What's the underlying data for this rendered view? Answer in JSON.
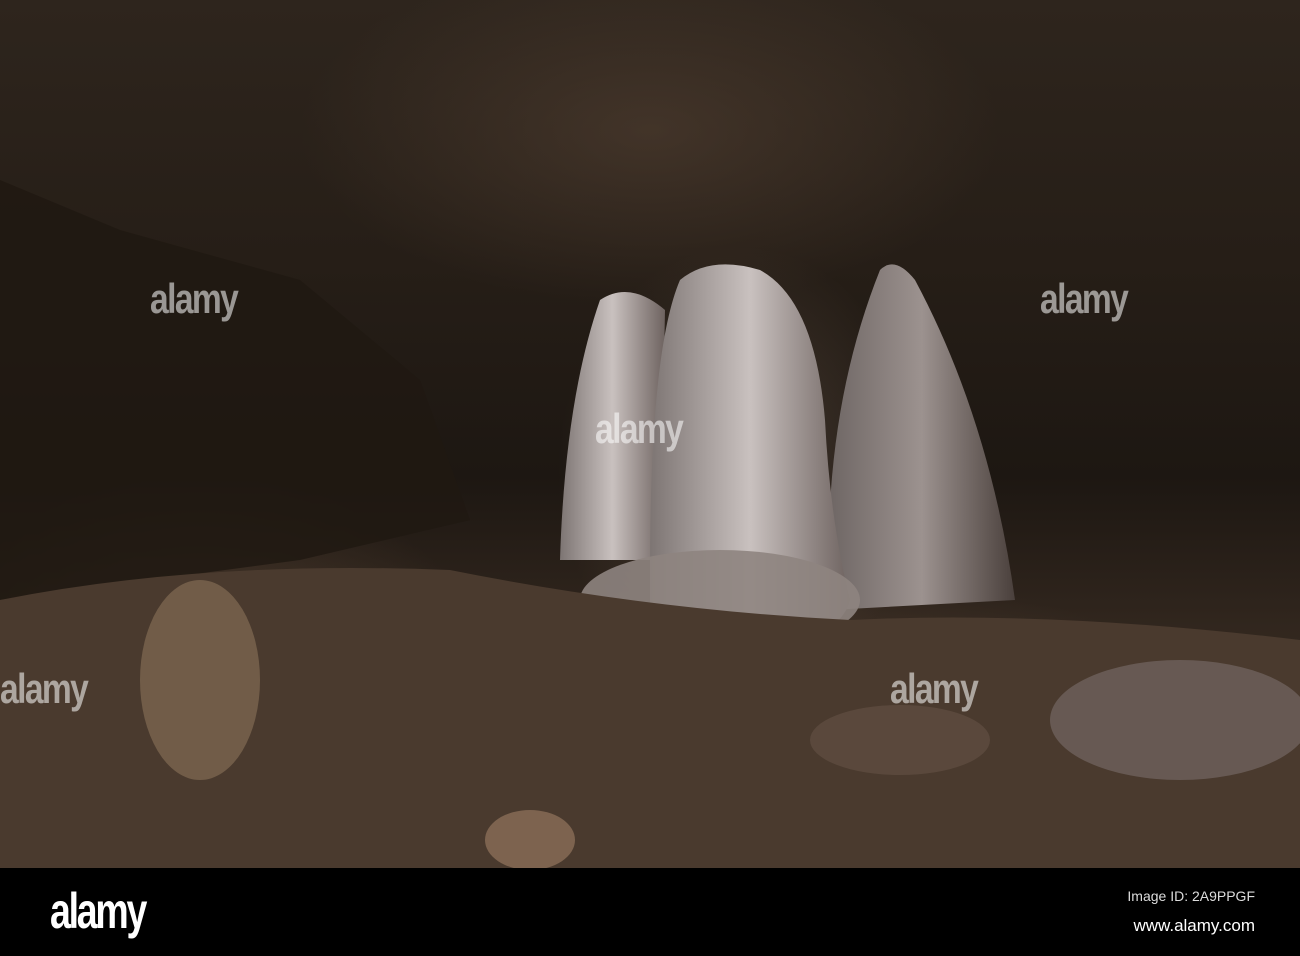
{
  "watermark": "alamy",
  "footer": {
    "logo": "alamy",
    "image_id": "Image ID: 2A9PPGF",
    "site": "www.alamy.com"
  }
}
